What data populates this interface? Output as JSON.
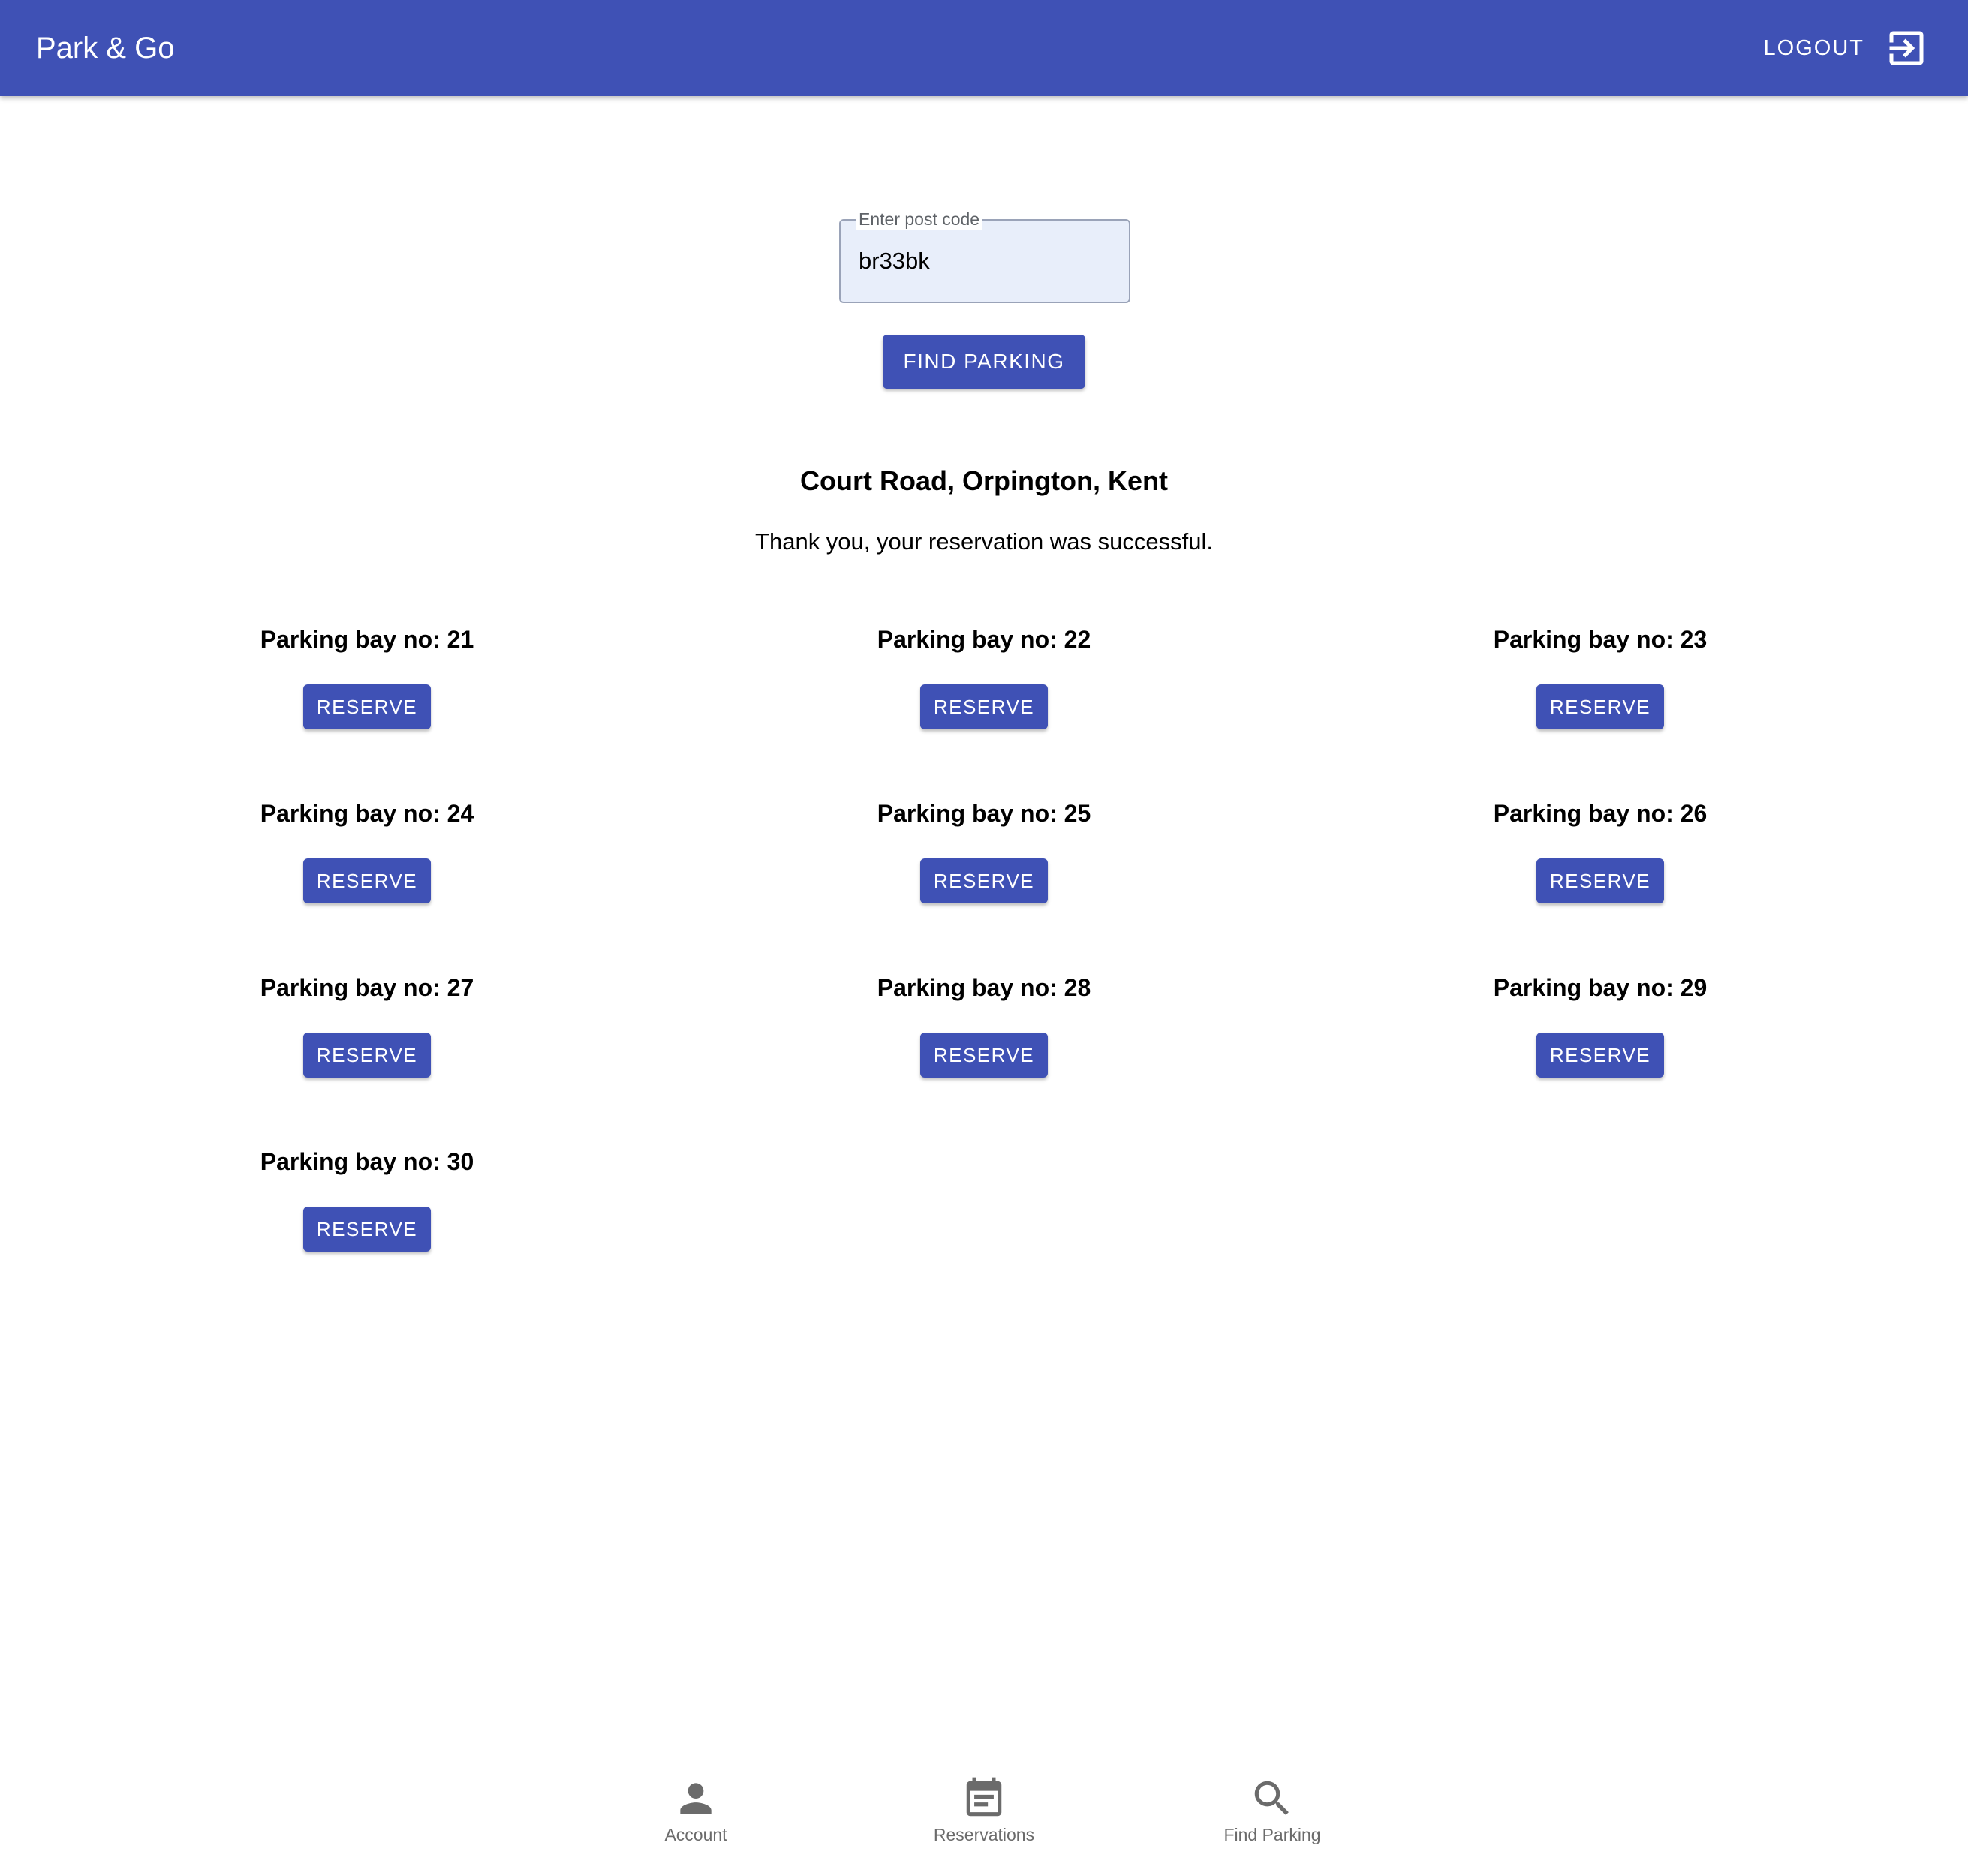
{
  "header": {
    "title": "Park & Go",
    "logout_label": "LOGOUT",
    "logout_icon": "exit-to-app-icon",
    "bg_color": "#3f51b5"
  },
  "search": {
    "legend": "Enter post code",
    "value": "br33bk",
    "button_label": "FIND PARKING"
  },
  "result": {
    "location": "Court Road, Orpington, Kent",
    "message": "Thank you, your reservation was successful."
  },
  "bays": [
    {
      "label": "Parking bay no: 21",
      "button": "RESERVE"
    },
    {
      "label": "Parking bay no: 22",
      "button": "RESERVE"
    },
    {
      "label": "Parking bay no: 23",
      "button": "RESERVE"
    },
    {
      "label": "Parking bay no: 24",
      "button": "RESERVE"
    },
    {
      "label": "Parking bay no: 25",
      "button": "RESERVE"
    },
    {
      "label": "Parking bay no: 26",
      "button": "RESERVE"
    },
    {
      "label": "Parking bay no: 27",
      "button": "RESERVE"
    },
    {
      "label": "Parking bay no: 28",
      "button": "RESERVE"
    },
    {
      "label": "Parking bay no: 29",
      "button": "RESERVE"
    },
    {
      "label": "Parking bay no: 30",
      "button": "RESERVE"
    }
  ],
  "bottom_nav": [
    {
      "label": "Account",
      "icon": "person-icon"
    },
    {
      "label": "Reservations",
      "icon": "calendar-icon"
    },
    {
      "label": "Find Parking",
      "icon": "search-icon"
    }
  ],
  "colors": {
    "primary": "#3f51b5",
    "input_bg": "#e8eefa",
    "nav_icon": "#6b6b6b"
  }
}
